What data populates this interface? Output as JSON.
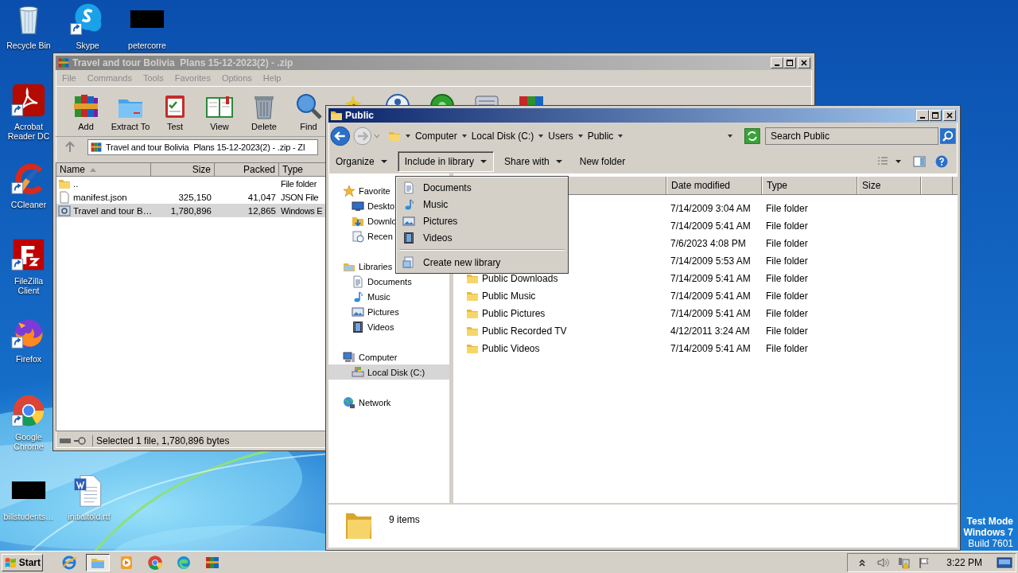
{
  "desktop_icons": [
    {
      "kind": "trash",
      "label": "Recycle Bin",
      "shortcut": false
    },
    {
      "kind": "chat",
      "label": "Skype",
      "shortcut": true
    },
    {
      "kind": "redacted",
      "label": "petercorre",
      "shortcut": false
    },
    {
      "kind": "pdf",
      "label": "Acrobat Reader DC",
      "shortcut": true
    },
    {
      "kind": "broom",
      "label": "CCleaner",
      "shortcut": true
    },
    {
      "kind": "ftp",
      "label": "FileZilla Client",
      "shortcut": true
    },
    {
      "kind": "fox",
      "label": "Firefox",
      "shortcut": true
    },
    {
      "kind": "chrome",
      "label": "Google Chrome",
      "shortcut": true
    },
    {
      "kind": "redacted",
      "label": "billstudents…",
      "shortcut": false
    },
    {
      "kind": "word",
      "label": "initialtold.rtf",
      "shortcut": false
    }
  ],
  "archiver": {
    "title": "Travel and tour Bolivia  Plans 15-12-2023(2) - .zip",
    "menu": [
      "File",
      "Commands",
      "Tools",
      "Favorites",
      "Options",
      "Help"
    ],
    "tools": [
      {
        "kind": "add",
        "label": "Add"
      },
      {
        "kind": "extract",
        "label": "Extract To"
      },
      {
        "kind": "test",
        "label": "Test"
      },
      {
        "kind": "view",
        "label": "View"
      },
      {
        "kind": "delete",
        "label": "Delete"
      },
      {
        "kind": "find",
        "label": "Find"
      },
      {
        "kind": "wizard"
      },
      {
        "kind": "info"
      },
      {
        "kind": "virus"
      },
      {
        "kind": "comment"
      },
      {
        "kind": "sfx"
      }
    ],
    "path": "Travel and tour Bolivia  Plans 15-12-2023(2) - .zip - ZI",
    "columns": [
      {
        "label": "Name",
        "sorted": true
      },
      {
        "label": "Size",
        "sorted": false
      },
      {
        "label": "Packed",
        "sorted": false
      },
      {
        "label": "Type",
        "sorted": false
      }
    ],
    "rows": [
      {
        "kind": "up",
        "name": "..",
        "type": "File folder",
        "selected": false
      },
      {
        "kind": "file",
        "name": "manifest.json",
        "size": "325,150",
        "packed": "41,047",
        "type": "JSON File",
        "selected": false
      },
      {
        "kind": "exe",
        "name": "Travel and tour B…",
        "size": "1,780,896",
        "packed": "12,865",
        "type": "Windows E",
        "selected": true
      }
    ],
    "status": "Selected 1 file, 1,780,896 bytes"
  },
  "explorer": {
    "title": "Public",
    "breadcrumb": [
      "Computer",
      "Local Disk (C:)",
      "Users",
      "Public"
    ],
    "search": {
      "placeholder": "Search Public"
    },
    "commands": [
      {
        "label": "Organize",
        "kind": "menu",
        "expanded": false
      },
      {
        "label": "Include in library",
        "kind": "menu",
        "expanded": true
      },
      {
        "label": "Share with",
        "kind": "menu",
        "expanded": false
      },
      {
        "label": "New folder",
        "kind": "button",
        "expanded": false
      }
    ],
    "nav": [
      {
        "kind": "star",
        "label": "Favorite",
        "selected": false,
        "children": [
          {
            "kind": "desktop",
            "label": "Deskto",
            "selected": false
          },
          {
            "kind": "download",
            "label": "Downlo",
            "selected": false
          },
          {
            "kind": "recent",
            "label": "Recen",
            "selected": false
          }
        ]
      },
      {
        "kind": "library",
        "label": "Libraries",
        "selected": false,
        "children": [
          {
            "kind": "documents",
            "label": "Documents",
            "selected": false
          },
          {
            "kind": "music",
            "label": "Music",
            "selected": false
          },
          {
            "kind": "pictures",
            "label": "Pictures",
            "selected": false
          },
          {
            "kind": "videos",
            "label": "Videos",
            "selected": false
          }
        ]
      },
      {
        "kind": "computer",
        "label": "Computer",
        "selected": false,
        "children": [
          {
            "kind": "disk",
            "label": "Local Disk (C:)",
            "selected": true
          }
        ]
      },
      {
        "kind": "network",
        "label": "Network",
        "selected": false
      }
    ],
    "library_menu": [
      {
        "kind": "documents",
        "label": "Documents"
      },
      {
        "kind": "music",
        "label": "Music"
      },
      {
        "kind": "pictures",
        "label": "Pictures"
      },
      {
        "kind": "videos",
        "label": "Videos"
      },
      {
        "kind": "new",
        "label": "Create new library"
      }
    ],
    "columns": [
      "Date modified",
      "Type",
      "Size"
    ],
    "rows": [
      {
        "date": "7/14/2009 3:04 AM",
        "type": "File folder"
      },
      {
        "date": "7/14/2009 5:41 AM",
        "type": "File folder"
      },
      {
        "date": "7/6/2023 4:08 PM",
        "type": "File folder"
      },
      {
        "date": "7/14/2009 5:53 AM",
        "type": "File folder"
      },
      {
        "name": "Public Downloads",
        "date": "7/14/2009 5:41 AM",
        "type": "File folder"
      },
      {
        "name": "Public Music",
        "date": "7/14/2009 5:41 AM",
        "type": "File folder"
      },
      {
        "name": "Public Pictures",
        "date": "7/14/2009 5:41 AM",
        "type": "File folder"
      },
      {
        "name": "Public Recorded TV",
        "date": "4/12/2011 3:24 AM",
        "type": "File folder"
      },
      {
        "name": "Public Videos",
        "date": "7/14/2009 5:41 AM",
        "type": "File folder"
      }
    ],
    "details": "9 items"
  },
  "os_notice": [
    {
      "kind": "heading",
      "text": "Test Mode"
    },
    {
      "kind": "heading",
      "text": "Windows 7"
    },
    {
      "kind": "build",
      "text": "Build 7601"
    }
  ],
  "taskbar": {
    "start": "Start",
    "apps": [
      {
        "kind": "ie",
        "selected": false
      },
      {
        "kind": "explorer",
        "selected": true
      },
      {
        "kind": "media",
        "selected": false
      },
      {
        "kind": "chrome",
        "selected": false
      },
      {
        "kind": "edge",
        "selected": false
      },
      {
        "kind": "archiver",
        "selected": false
      }
    ],
    "tray": [
      {
        "kind": "chevron"
      },
      {
        "kind": "speaker"
      },
      {
        "kind": "network"
      },
      {
        "kind": "flag"
      }
    ],
    "clock": "3:22 PM"
  }
}
